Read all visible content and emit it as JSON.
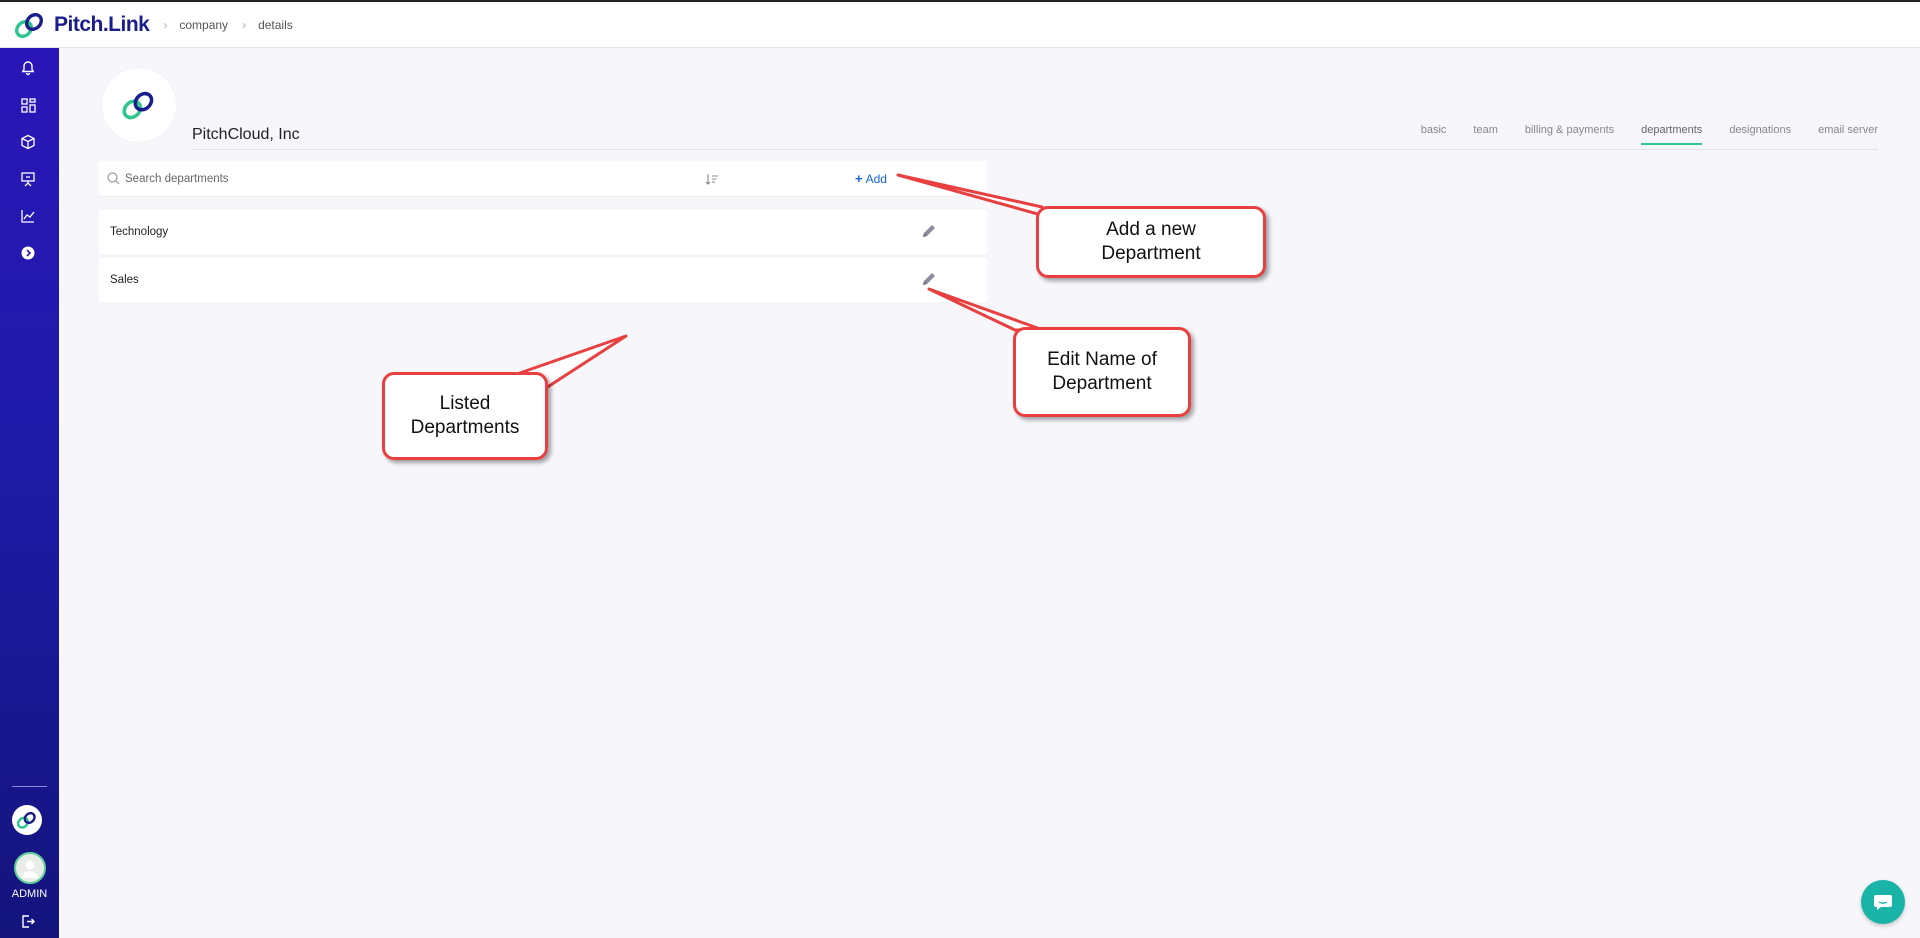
{
  "app": {
    "name": "Pitch.Link"
  },
  "breadcrumb": [
    "company",
    "details"
  ],
  "sidebar": {
    "icons": [
      "bell-icon",
      "dashboard-icon",
      "box-icon",
      "presentation-icon",
      "chart-icon",
      "chevron-circle-icon"
    ],
    "user_label": "ADMIN"
  },
  "company": {
    "name": "PitchCloud, Inc"
  },
  "tabs": [
    {
      "label": "basic",
      "active": false
    },
    {
      "label": "team",
      "active": false
    },
    {
      "label": "billing & payments",
      "active": false
    },
    {
      "label": "departments",
      "active": true
    },
    {
      "label": "designations",
      "active": false
    },
    {
      "label": "email server",
      "active": false
    }
  ],
  "search": {
    "placeholder": "Search departments",
    "value": ""
  },
  "toolbar": {
    "add_label": "Add"
  },
  "departments": [
    {
      "name": "Technology"
    },
    {
      "name": "Sales"
    }
  ],
  "callouts": {
    "add": "Add a new Department",
    "edit": "Edit Name of Department",
    "listed": "Listed Departments"
  },
  "colors": {
    "brand": "#1a1e8c",
    "sidebar": "#2a16b8",
    "accent": "#2fc68e",
    "link": "#1565d8",
    "callout_border": "#e84040",
    "chat": "#1ab3a8"
  }
}
